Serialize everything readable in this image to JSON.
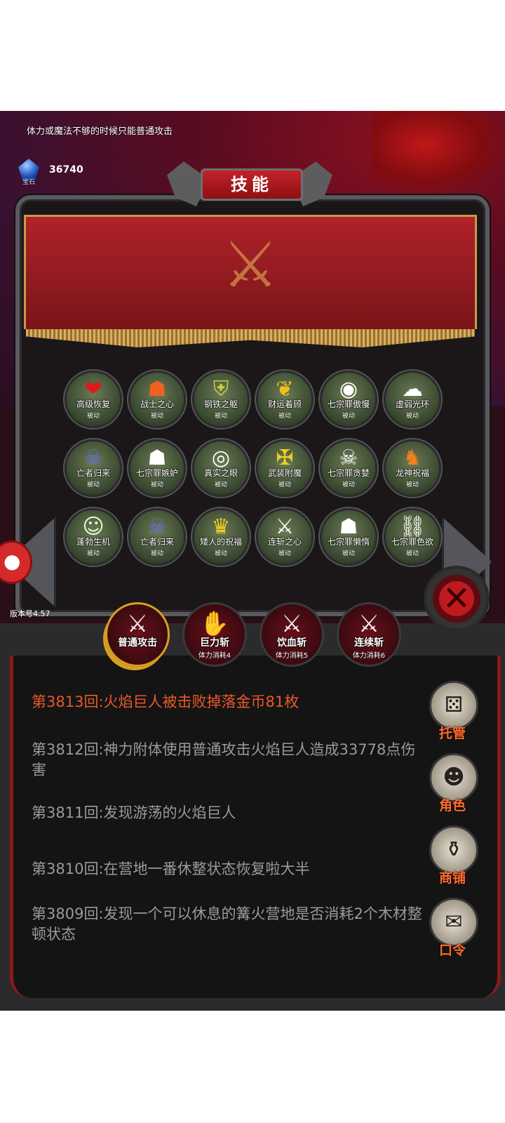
{
  "tip": "体力或魔法不够的时候只能普通攻击",
  "gem": {
    "caption": "宝石",
    "count": "36740"
  },
  "panel": {
    "title": "技能"
  },
  "skills": [
    {
      "name": "高级恢复",
      "sub": "被动",
      "icon": "heart-icon",
      "glyph": "❤",
      "color": "#e01818"
    },
    {
      "name": "战士之心",
      "sub": "被动",
      "icon": "helmet-icon",
      "glyph": "☗",
      "color": "#f06020"
    },
    {
      "name": "钢铁之躯",
      "sub": "被动",
      "icon": "armor-icon",
      "glyph": "⛨",
      "color": "#c8d040"
    },
    {
      "name": "财运着顾",
      "sub": "被动",
      "icon": "wings-icon",
      "glyph": "❦",
      "color": "#f0c020"
    },
    {
      "name": "七宗罪傲慢",
      "sub": "被动",
      "icon": "eye-icon",
      "glyph": "◉",
      "color": "#ffffff"
    },
    {
      "name": "虚弱光环",
      "sub": "被动",
      "icon": "ghost-icon",
      "glyph": "☁",
      "color": "#ffffff"
    },
    {
      "name": "亡者归来",
      "sub": "被动",
      "icon": "horned-skull-icon",
      "glyph": "☠",
      "color": "#6070e0"
    },
    {
      "name": "七宗罪嫉妒",
      "sub": "被动",
      "icon": "hood-icon",
      "glyph": "☗",
      "color": "#ffffff"
    },
    {
      "name": "真实之眼",
      "sub": "被动",
      "icon": "spiral-eye-icon",
      "glyph": "◎",
      "color": "#ffffff"
    },
    {
      "name": "武装附魔",
      "sub": "被动",
      "icon": "winged-sword-icon",
      "glyph": "✠",
      "color": "#f0d020"
    },
    {
      "name": "七宗罪贪婪",
      "sub": "被动",
      "icon": "skull-icon",
      "glyph": "☠",
      "color": "#ffffff"
    },
    {
      "name": "龙神祝福",
      "sub": "被动",
      "icon": "dragon-icon",
      "glyph": "♞",
      "color": "#f08020"
    },
    {
      "name": "蓬勃生机",
      "sub": "被动",
      "icon": "muscle-icon",
      "glyph": "☺",
      "color": "#e0ffd0"
    },
    {
      "name": "亡者归来",
      "sub": "被动",
      "icon": "horned-skull-icon",
      "glyph": "☠",
      "color": "#6070e0"
    },
    {
      "name": "矮人的祝福",
      "sub": "被动",
      "icon": "viking-icon",
      "glyph": "♛",
      "color": "#f0d020"
    },
    {
      "name": "连斩之心",
      "sub": "被动",
      "icon": "slash-icon",
      "glyph": "⚔",
      "color": "#ffffff"
    },
    {
      "name": "七宗罪懒惰",
      "sub": "被动",
      "icon": "mask-icon",
      "glyph": "☗",
      "color": "#ffffff"
    },
    {
      "name": "七宗罪色欲",
      "sub": "被动",
      "icon": "chain-icon",
      "glyph": "⛓",
      "color": "#ffffff"
    }
  ],
  "version": "版本号4.57",
  "actions": [
    {
      "name": "普通攻击",
      "cost": "",
      "icon": "sword-strike-icon",
      "glyph": "⚔"
    },
    {
      "name": "巨力斩",
      "cost": "体力消耗4",
      "icon": "claw-icon",
      "glyph": "✋"
    },
    {
      "name": "饮血斩",
      "cost": "体力消耗5",
      "icon": "blood-sword-icon",
      "glyph": "⚔"
    },
    {
      "name": "连续斩",
      "cost": "体力消耗6",
      "icon": "multi-sword-icon",
      "glyph": "⚔"
    }
  ],
  "log": [
    {
      "text": "第3813回:火焰巨人被击败掉落金币81枚",
      "highlight": true
    },
    {
      "text": "第3812回:神力附体使用普通攻击火焰巨人造成33778点伤害",
      "highlight": false
    },
    {
      "text": "第3811回:发现游荡的火焰巨人",
      "highlight": false
    },
    {
      "text": "第3810回:在营地一番休整状态恢复啦大半",
      "highlight": false
    },
    {
      "text": "第3809回:发现一个可以休息的篝火营地是否消耗2个木材整顿状态",
      "highlight": false
    }
  ],
  "side": [
    {
      "label": "托管",
      "icon": "dice-icon",
      "glyph": "⚄"
    },
    {
      "label": "角色",
      "icon": "hooded-figure-icon",
      "glyph": "☻"
    },
    {
      "label": "商铺",
      "icon": "shop-bag-icon",
      "glyph": "⚱"
    },
    {
      "label": "口令",
      "icon": "scroll-icon",
      "glyph": "✉"
    }
  ]
}
